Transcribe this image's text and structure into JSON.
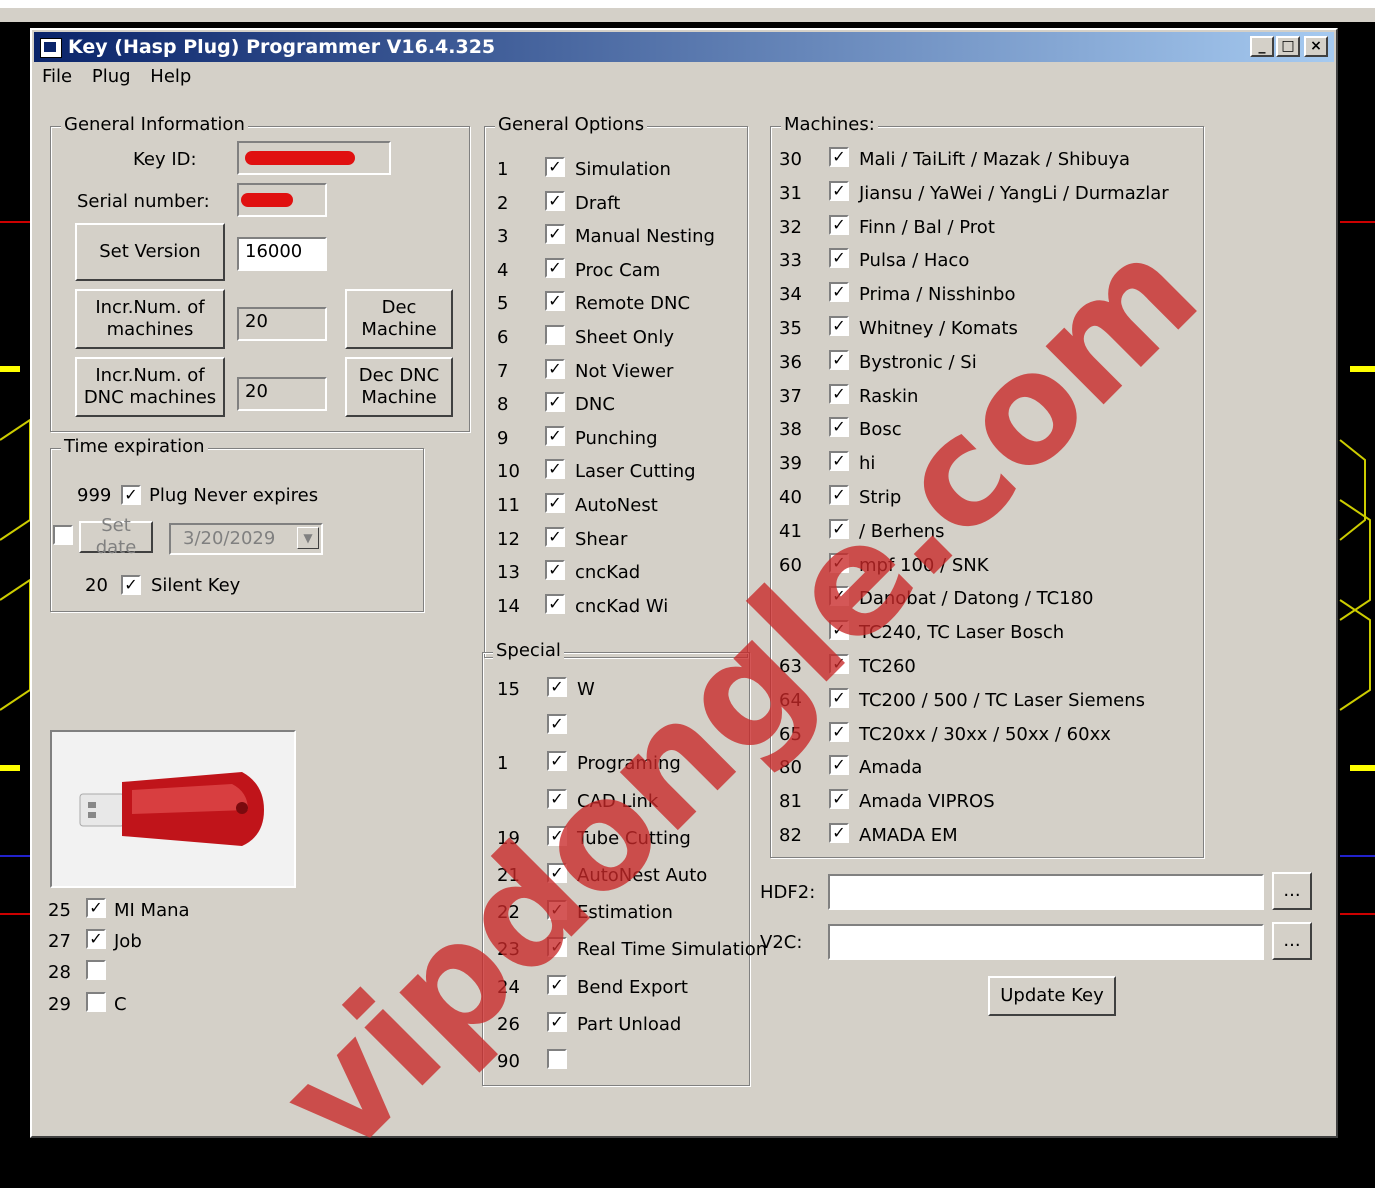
{
  "window": {
    "title": "Key (Hasp Plug) Programmer V16.4.325",
    "controls": {
      "minimize": "_",
      "maximize": "□",
      "close": "×"
    }
  },
  "menu": [
    "File",
    "Plug",
    "Help"
  ],
  "general_info": {
    "title": "General Information",
    "key_id_label": "Key ID:",
    "serial_label": "Serial number:",
    "set_version_label": "Set Version",
    "version_value": "16000",
    "incr_machines_label": "Incr.Num. of machines",
    "machines_value": "20",
    "dec_machine_label": "Dec Machine",
    "incr_dnc_label": "Incr.Num. of DNC machines",
    "dnc_value": "20",
    "dec_dnc_label": "Dec DNC Machine"
  },
  "time_expiration": {
    "title": "Time expiration",
    "never_num": "999",
    "never_label": "Plug Never expires",
    "never_checked": true,
    "set_date_checked": false,
    "set_date_label": "Set date",
    "date_value": "3/20/2029",
    "silent_num": "20",
    "silent_label": "Silent Key",
    "silent_checked": true
  },
  "left_options": [
    {
      "num": "25",
      "label": "MI Mana",
      "checked": true
    },
    {
      "num": "27",
      "label": "Job",
      "checked": true
    },
    {
      "num": "28",
      "label": "",
      "checked": false
    },
    {
      "num": "29",
      "label": "C",
      "checked": false
    }
  ],
  "general_options": {
    "title": "General Options",
    "items": [
      {
        "num": "1",
        "label": "Simulation",
        "checked": true
      },
      {
        "num": "2",
        "label": "Draft",
        "checked": true
      },
      {
        "num": "3",
        "label": "Manual Nesting",
        "checked": true
      },
      {
        "num": "4",
        "label": "Proc Cam",
        "checked": true
      },
      {
        "num": "5",
        "label": "Remote DNC",
        "checked": true
      },
      {
        "num": "6",
        "label": "Sheet Only",
        "checked": false
      },
      {
        "num": "7",
        "label": "Not Viewer",
        "checked": true
      },
      {
        "num": "8",
        "label": "DNC",
        "checked": true
      },
      {
        "num": "9",
        "label": "Punching",
        "checked": true
      },
      {
        "num": "10",
        "label": "Laser Cutting",
        "checked": true
      },
      {
        "num": "11",
        "label": "AutoNest",
        "checked": true
      },
      {
        "num": "12",
        "label": "Shear",
        "checked": true
      },
      {
        "num": "13",
        "label": "cncKad",
        "checked": true
      },
      {
        "num": "14",
        "label": "cncKad Wi",
        "checked": true
      }
    ]
  },
  "special_options": {
    "title": "Special",
    "items": [
      {
        "num": "15",
        "label": "W",
        "checked": true
      },
      {
        "num": "",
        "label": "",
        "checked": true
      },
      {
        "num": "1",
        "label": "Programing",
        "checked": true
      },
      {
        "num": "",
        "label": "CAD Link",
        "checked": true
      },
      {
        "num": "19",
        "label": "Tube Cutting",
        "checked": true
      },
      {
        "num": "21",
        "label": "AutoNest Auto",
        "checked": true
      },
      {
        "num": "22",
        "label": "Estimation",
        "checked": true
      },
      {
        "num": "23",
        "label": "Real Time Simulation",
        "checked": true
      },
      {
        "num": "24",
        "label": "Bend Export",
        "checked": true
      },
      {
        "num": "26",
        "label": "Part Unload",
        "checked": true
      },
      {
        "num": "90",
        "label": "",
        "checked": false
      }
    ]
  },
  "machines": {
    "title": "Machines:",
    "items": [
      {
        "num": "30",
        "label": "Mali / TaiLift / Mazak / Shibuya",
        "checked": true
      },
      {
        "num": "31",
        "label": "Jiansu / YaWei / YangLi / Durmazlar",
        "checked": true
      },
      {
        "num": "32",
        "label": "Finn / Bal / Prot",
        "checked": true
      },
      {
        "num": "33",
        "label": "Pulsa / Haco",
        "checked": true
      },
      {
        "num": "34",
        "label": "Prima / Nisshinbo",
        "checked": true
      },
      {
        "num": "35",
        "label": "Whitney / Komats",
        "checked": true
      },
      {
        "num": "36",
        "label": "Bystronic / Si",
        "checked": true
      },
      {
        "num": "37",
        "label": "Raskin",
        "checked": true
      },
      {
        "num": "38",
        "label": "Bosc",
        "checked": true
      },
      {
        "num": "39",
        "label": "hi",
        "checked": true
      },
      {
        "num": "40",
        "label": "Strip",
        "checked": true
      },
      {
        "num": "41",
        "label": "/ Berhens",
        "checked": true
      },
      {
        "num": "60",
        "label": "mpf 100 / SNK",
        "checked": true
      },
      {
        "num": "",
        "label": "Danobat / Datong / TC180",
        "checked": true
      },
      {
        "num": "",
        "label": "TC240,  TC Laser Bosch",
        "checked": true
      },
      {
        "num": "63",
        "label": "TC260",
        "checked": true
      },
      {
        "num": "64",
        "label": "TC200 / 500 / TC Laser Siemens",
        "checked": true
      },
      {
        "num": "65",
        "label": "TC20xx / 30xx / 50xx / 60xx",
        "checked": true
      },
      {
        "num": "80",
        "label": "Amada",
        "checked": true
      },
      {
        "num": "81",
        "label": "Amada VIPROS",
        "checked": true
      },
      {
        "num": "82",
        "label": "AMADA EM",
        "checked": true
      }
    ]
  },
  "files": {
    "hdf2_label": "HDF2:",
    "v2c_label": "V2C:",
    "browse_label": "...",
    "update_label": "Update Key"
  },
  "watermark": "vipdongle.com",
  "colors": {
    "titlebar_start": "#0a246a",
    "titlebar_end": "#a6caf0",
    "face": "#d4d0c8",
    "watermark": "#c82828"
  }
}
